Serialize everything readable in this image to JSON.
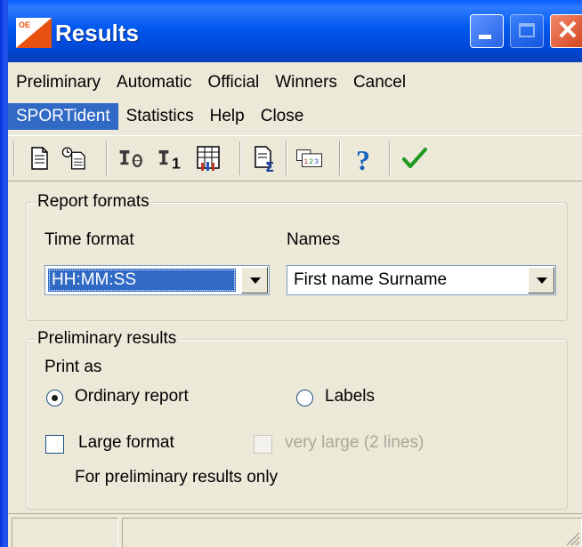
{
  "window": {
    "title": "Results",
    "controls": {
      "minimize": "minimize",
      "maximize": "maximize",
      "close": "close"
    }
  },
  "menu": {
    "row1": [
      "Preliminary",
      "Automatic",
      "Official",
      "Winners",
      "Cancel"
    ],
    "row2": [
      "SPORTident",
      "Statistics",
      "Help",
      "Close"
    ],
    "active": "SPORTident"
  },
  "toolbar": {
    "icons": [
      "document-icon",
      "clock-document-icon",
      "trophy-zero-icon",
      "trophy-one-icon",
      "table-people-icon",
      "sum-report-icon",
      "numbers-icon",
      "help-icon",
      "check-icon"
    ]
  },
  "report_formats": {
    "legend": "Report formats",
    "time_format_label": "Time format",
    "time_format_value": "HH:MM:SS",
    "names_label": "Names",
    "names_value": "First name Surname"
  },
  "preliminary": {
    "legend": "Preliminary results",
    "print_as_label": "Print as",
    "ordinary_label": "Ordinary report",
    "labels_label": "Labels",
    "selected": "Ordinary report",
    "large_format_label": "Large format",
    "large_format_checked": false,
    "very_large_label": "very large (2 lines)",
    "very_large_enabled": false,
    "note": "For preliminary results only"
  },
  "colors": {
    "titlebar": "#0054e3",
    "selection": "#316ac5",
    "face": "#ece9d8",
    "check_green": "#1f9a1f",
    "help_blue": "#1565c0"
  }
}
